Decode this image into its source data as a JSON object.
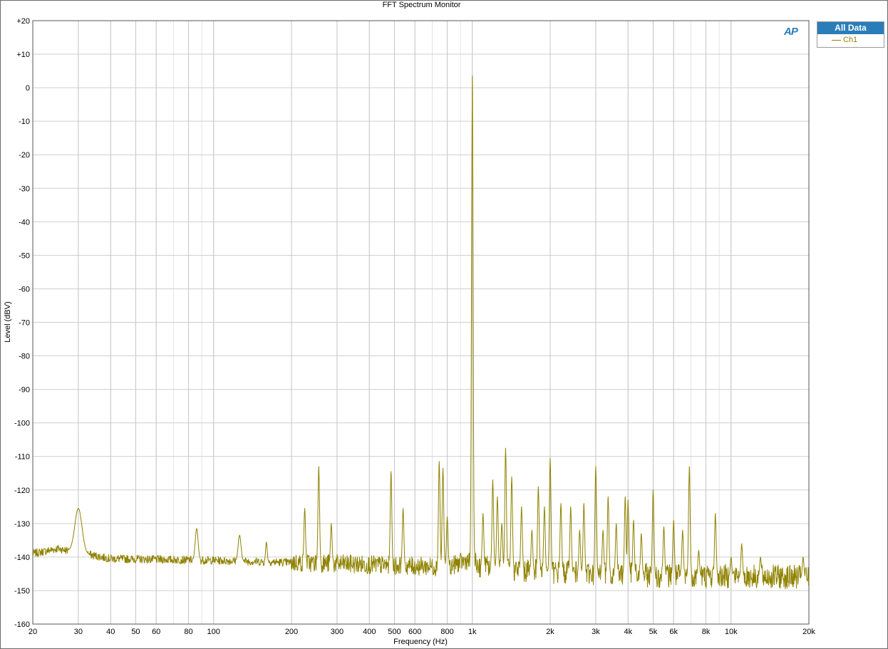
{
  "window": {
    "title": "FFT Spectrum Monitor"
  },
  "legend": {
    "header": "All Data",
    "entries": [
      {
        "label": "Ch1",
        "color": "#8f8200"
      }
    ]
  },
  "logo": {
    "text": "AP",
    "color": "#2a7db8"
  },
  "chart_data": {
    "type": "line",
    "title": "FFT Spectrum Monitor",
    "xlabel": "Frequency (Hz)",
    "ylabel": "Level (dBV)",
    "xscale": "log",
    "xlim": [
      20,
      20000
    ],
    "ylim": [
      -160,
      20
    ],
    "grid": true,
    "legend_position": "top-right, outside plot",
    "x_ticks": [
      {
        "value": 20,
        "label": "20"
      },
      {
        "value": 30,
        "label": "30"
      },
      {
        "value": 40,
        "label": "40"
      },
      {
        "value": 50,
        "label": "50"
      },
      {
        "value": 60,
        "label": "60"
      },
      {
        "value": 80,
        "label": "80"
      },
      {
        "value": 100,
        "label": "100"
      },
      {
        "value": 200,
        "label": "200"
      },
      {
        "value": 300,
        "label": "300"
      },
      {
        "value": 400,
        "label": "400"
      },
      {
        "value": 500,
        "label": "500"
      },
      {
        "value": 600,
        "label": "600"
      },
      {
        "value": 800,
        "label": "800"
      },
      {
        "value": 1000,
        "label": "1k"
      },
      {
        "value": 2000,
        "label": "2k"
      },
      {
        "value": 3000,
        "label": "3k"
      },
      {
        "value": 4000,
        "label": "4k"
      },
      {
        "value": 5000,
        "label": "5k"
      },
      {
        "value": 6000,
        "label": "6k"
      },
      {
        "value": 8000,
        "label": "8k"
      },
      {
        "value": 10000,
        "label": "10k"
      },
      {
        "value": 20000,
        "label": "20k"
      }
    ],
    "y_ticks": [
      {
        "value": 20,
        "label": "+20"
      },
      {
        "value": 10,
        "label": "+10"
      },
      {
        "value": 0,
        "label": "0"
      },
      {
        "value": -10,
        "label": "-10"
      },
      {
        "value": -20,
        "label": "-20"
      },
      {
        "value": -30,
        "label": "-30"
      },
      {
        "value": -40,
        "label": "-40"
      },
      {
        "value": -50,
        "label": "-50"
      },
      {
        "value": -60,
        "label": "-60"
      },
      {
        "value": -70,
        "label": "-70"
      },
      {
        "value": -80,
        "label": "-80"
      },
      {
        "value": -90,
        "label": "-90"
      },
      {
        "value": -100,
        "label": "-100"
      },
      {
        "value": -110,
        "label": "-110"
      },
      {
        "value": -120,
        "label": "-120"
      },
      {
        "value": -130,
        "label": "-130"
      },
      {
        "value": -140,
        "label": "-140"
      },
      {
        "value": -150,
        "label": "-150"
      },
      {
        "value": -160,
        "label": "-160"
      }
    ],
    "series": [
      {
        "name": "Ch1",
        "color": "#8f8200",
        "floor": [
          {
            "x": 20,
            "y": -139
          },
          {
            "x": 25,
            "y": -137.5
          },
          {
            "x": 40,
            "y": -140.5
          },
          {
            "x": 100,
            "y": -141
          },
          {
            "x": 300,
            "y": -142
          },
          {
            "x": 800,
            "y": -143
          },
          {
            "x": 950,
            "y": -141
          },
          {
            "x": 1100,
            "y": -143
          },
          {
            "x": 2000,
            "y": -144.5
          },
          {
            "x": 5000,
            "y": -145.5
          },
          {
            "x": 20000,
            "y": -146
          }
        ],
        "peaks": [
          {
            "x": 30,
            "y": -125.5
          },
          {
            "x": 86,
            "y": -131.5
          },
          {
            "x": 126,
            "y": -133.5
          },
          {
            "x": 160,
            "y": -135.5
          },
          {
            "x": 225,
            "y": -125.5
          },
          {
            "x": 255,
            "y": -113
          },
          {
            "x": 285,
            "y": -130
          },
          {
            "x": 485,
            "y": -114.5
          },
          {
            "x": 540,
            "y": -125.5
          },
          {
            "x": 745,
            "y": -111.5
          },
          {
            "x": 770,
            "y": -113.5
          },
          {
            "x": 800,
            "y": -128
          },
          {
            "x": 1000,
            "y": 3.5
          },
          {
            "x": 1100,
            "y": -127
          },
          {
            "x": 1200,
            "y": -117
          },
          {
            "x": 1250,
            "y": -122
          },
          {
            "x": 1300,
            "y": -130
          },
          {
            "x": 1345,
            "y": -107.5
          },
          {
            "x": 1420,
            "y": -116
          },
          {
            "x": 1550,
            "y": -125
          },
          {
            "x": 1700,
            "y": -132
          },
          {
            "x": 1800,
            "y": -119
          },
          {
            "x": 1900,
            "y": -125
          },
          {
            "x": 2000,
            "y": -110.5
          },
          {
            "x": 2200,
            "y": -124
          },
          {
            "x": 2400,
            "y": -125
          },
          {
            "x": 2600,
            "y": -132
          },
          {
            "x": 2700,
            "y": -124
          },
          {
            "x": 3000,
            "y": -113
          },
          {
            "x": 3200,
            "y": -132
          },
          {
            "x": 3350,
            "y": -122
          },
          {
            "x": 3600,
            "y": -130
          },
          {
            "x": 3900,
            "y": -122
          },
          {
            "x": 4000,
            "y": -123
          },
          {
            "x": 4200,
            "y": -129
          },
          {
            "x": 4500,
            "y": -133
          },
          {
            "x": 5000,
            "y": -120
          },
          {
            "x": 5500,
            "y": -131
          },
          {
            "x": 6000,
            "y": -129
          },
          {
            "x": 6500,
            "y": -132
          },
          {
            "x": 6900,
            "y": -113
          },
          {
            "x": 7500,
            "y": -138
          },
          {
            "x": 8700,
            "y": -127
          },
          {
            "x": 10000,
            "y": -140
          },
          {
            "x": 11000,
            "y": -136
          },
          {
            "x": 13000,
            "y": -140
          },
          {
            "x": 19000,
            "y": -140
          }
        ]
      }
    ]
  }
}
